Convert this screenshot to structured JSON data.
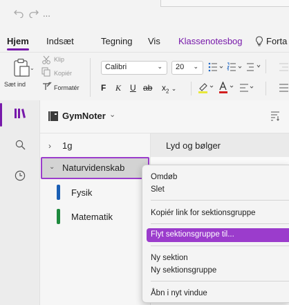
{
  "qat": {
    "undo_icon": "undo-icon",
    "redo_icon": "redo-icon",
    "more": "..."
  },
  "tabs": [
    {
      "label": "Hjem"
    },
    {
      "label": "Indsæt"
    },
    {
      "label": "Tegning"
    },
    {
      "label": "Vis"
    },
    {
      "label": "Klassenotesbog"
    },
    {
      "label": "Forta"
    }
  ],
  "ribbon": {
    "paste_label": "Sæt ind",
    "cut_label": "Klip",
    "copy_label": "Kopiér",
    "format_label": "Formatér",
    "font_name": "Calibri",
    "font_size": "20",
    "bold": "F",
    "italic": "K",
    "underline": "U",
    "strike": "ab",
    "subscript": "x",
    "sub_mark": "2"
  },
  "notebook": {
    "name": "GymNoter"
  },
  "sections": [
    {
      "label": "1g"
    },
    {
      "label": "Naturvidenskab"
    },
    {
      "label": "Fysik",
      "color": "#1a5fb4"
    },
    {
      "label": "Matematik",
      "color": "#1e8a3e"
    }
  ],
  "page": {
    "title": "Lyd og bølger"
  },
  "context_menu": [
    {
      "label": "Omdøb"
    },
    {
      "label": "Slet"
    },
    {
      "label": "Kopiér link for sektionsgruppe"
    },
    {
      "label": "Flyt sektionsgruppe til..."
    },
    {
      "label": "Ny sektion"
    },
    {
      "label": "Ny sektionsgruppe"
    },
    {
      "label": "Åbn i nyt vindue"
    }
  ],
  "colors": {
    "accent": "#7719aa",
    "highlight": "#9b3ccc"
  }
}
